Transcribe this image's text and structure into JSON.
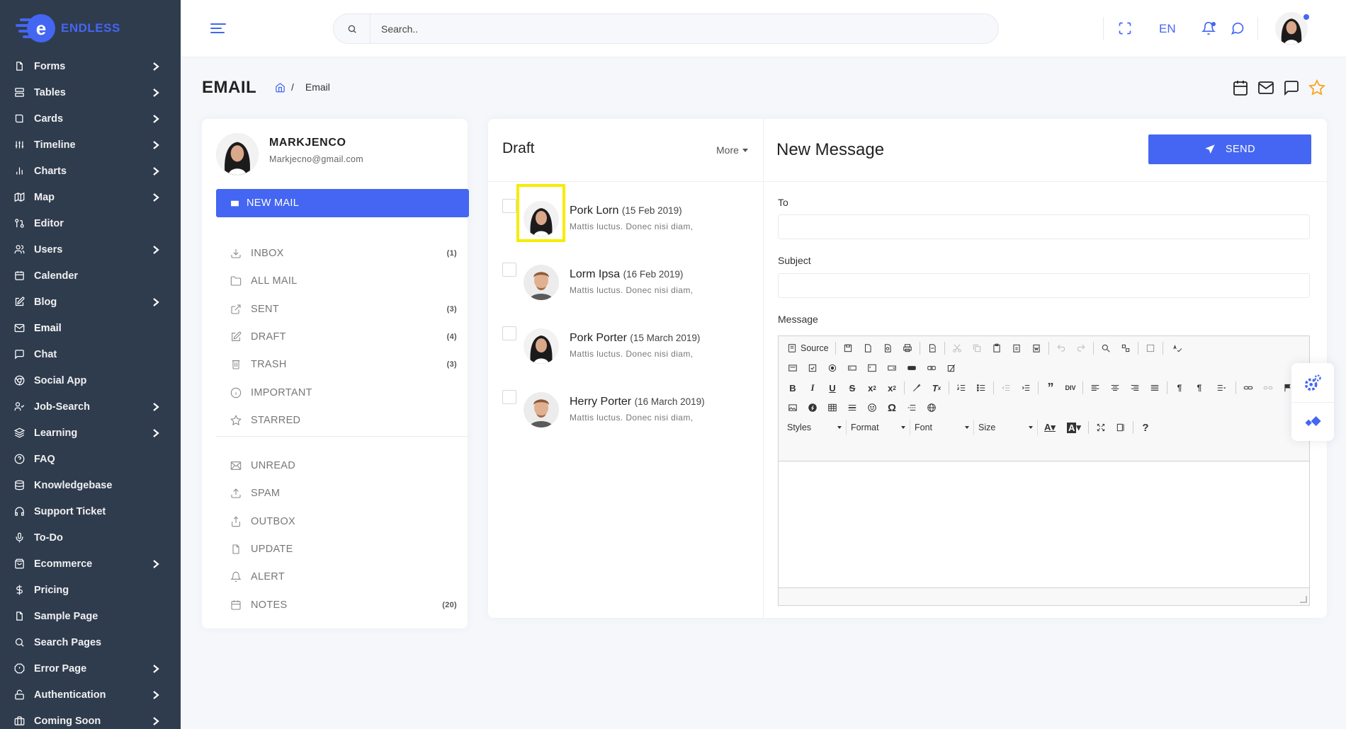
{
  "brand": {
    "name": "ENDLESS",
    "letter": "e",
    "color": "#4466f2"
  },
  "sidebar": {
    "items": [
      {
        "label": "Forms",
        "icon": "file-icon",
        "chevron": true
      },
      {
        "label": "Tables",
        "icon": "server-icon",
        "chevron": true
      },
      {
        "label": "Cards",
        "icon": "book-icon",
        "chevron": true
      },
      {
        "label": "Timeline",
        "icon": "sliders-icon",
        "chevron": true
      },
      {
        "label": "Charts",
        "icon": "bar-chart-icon",
        "chevron": true
      },
      {
        "label": "Map",
        "icon": "map-icon",
        "chevron": true
      },
      {
        "label": "Editor",
        "icon": "git-pull-request-icon",
        "chevron": false
      },
      {
        "label": "Users",
        "icon": "users-icon",
        "chevron": true
      },
      {
        "label": "Calender",
        "icon": "calendar-icon",
        "chevron": false
      },
      {
        "label": "Blog",
        "icon": "edit-icon",
        "chevron": true
      },
      {
        "label": "Email",
        "icon": "mail-icon",
        "chevron": false,
        "active": true
      },
      {
        "label": "Chat",
        "icon": "message-square-icon",
        "chevron": false
      },
      {
        "label": "Social App",
        "icon": "chrome-icon",
        "chevron": false
      },
      {
        "label": "Job-Search",
        "icon": "user-check-icon",
        "chevron": true
      },
      {
        "label": "Learning",
        "icon": "layers-icon",
        "chevron": true
      },
      {
        "label": "FAQ",
        "icon": "help-circle-icon",
        "chevron": false
      },
      {
        "label": "Knowledgebase",
        "icon": "database-icon",
        "chevron": false
      },
      {
        "label": "Support Ticket",
        "icon": "headphones-icon",
        "chevron": false
      },
      {
        "label": "To-Do",
        "icon": "mic-icon",
        "chevron": false
      },
      {
        "label": "Ecommerce",
        "icon": "shopping-bag-icon",
        "chevron": true
      },
      {
        "label": "Pricing",
        "icon": "dollar-sign-icon",
        "chevron": false
      },
      {
        "label": "Sample Page",
        "icon": "file-icon",
        "chevron": false
      },
      {
        "label": "Search Pages",
        "icon": "search-icon",
        "chevron": false
      },
      {
        "label": "Error Page",
        "icon": "alert-octagon-icon",
        "chevron": true
      },
      {
        "label": "Authentication",
        "icon": "unlock-icon",
        "chevron": true
      },
      {
        "label": "Coming Soon",
        "icon": "briefcase-icon",
        "chevron": true
      }
    ]
  },
  "topbar": {
    "search_placeholder": "Search..",
    "language": "EN"
  },
  "page": {
    "title": "EMAIL",
    "breadcrumb_current": "Email",
    "breadcrumb_sep": "/"
  },
  "profile": {
    "name": "MARKJENCO",
    "email": "Markjecno@gmail.com",
    "new_mail_label": "NEW MAIL"
  },
  "folders": [
    {
      "label": "INBOX",
      "count": "(1)",
      "icon": "download-icon"
    },
    {
      "label": "ALL MAIL",
      "count": "",
      "icon": "folder-icon"
    },
    {
      "label": "SENT",
      "count": "(3)",
      "icon": "external-link-icon"
    },
    {
      "label": "DRAFT",
      "count": "(4)",
      "icon": "edit-icon"
    },
    {
      "label": "TRASH",
      "count": "(3)",
      "icon": "trash-icon"
    },
    {
      "label": "IMPORTANT",
      "count": "",
      "icon": "info-icon"
    },
    {
      "label": "STARRED",
      "count": "",
      "icon": "star-icon"
    }
  ],
  "folders2": [
    {
      "label": "UNREAD",
      "count": "",
      "icon": "inbox-mail-icon"
    },
    {
      "label": "SPAM",
      "count": "",
      "icon": "upload-icon"
    },
    {
      "label": "OUTBOX",
      "count": "",
      "icon": "share-icon"
    },
    {
      "label": "UPDATE",
      "count": "",
      "icon": "file-icon"
    },
    {
      "label": "ALERT",
      "count": "",
      "icon": "bell-icon"
    },
    {
      "label": "NOTES",
      "count": "(20)",
      "icon": "calendar-icon"
    }
  ],
  "draft": {
    "title": "Draft",
    "more_label": "More",
    "mails": [
      {
        "name": "Pork Lorn",
        "date": "(15 Feb 2019)",
        "preview": "Mattis luctus. Donec nisi diam,",
        "avatar": "woman"
      },
      {
        "name": "Lorm Ipsa",
        "date": "(16 Feb 2019)",
        "preview": "Mattis luctus. Donec nisi diam,",
        "avatar": "man"
      },
      {
        "name": "Pork Porter",
        "date": "(15 March 2019)",
        "preview": "Mattis luctus. Donec nisi diam,",
        "avatar": "woman"
      },
      {
        "name": "Herry Porter",
        "date": "(16 March 2019)",
        "preview": "Mattis luctus. Donec nisi diam,",
        "avatar": "man"
      }
    ]
  },
  "compose": {
    "title": "New Message",
    "send_label": "SEND",
    "to_label": "To",
    "subject_label": "Subject",
    "message_label": "Message",
    "to_value": "",
    "subject_value": ""
  },
  "editor": {
    "source_label": "Source",
    "styles_label": "Styles",
    "format_label": "Format",
    "font_label": "Font",
    "size_label": "Size"
  }
}
